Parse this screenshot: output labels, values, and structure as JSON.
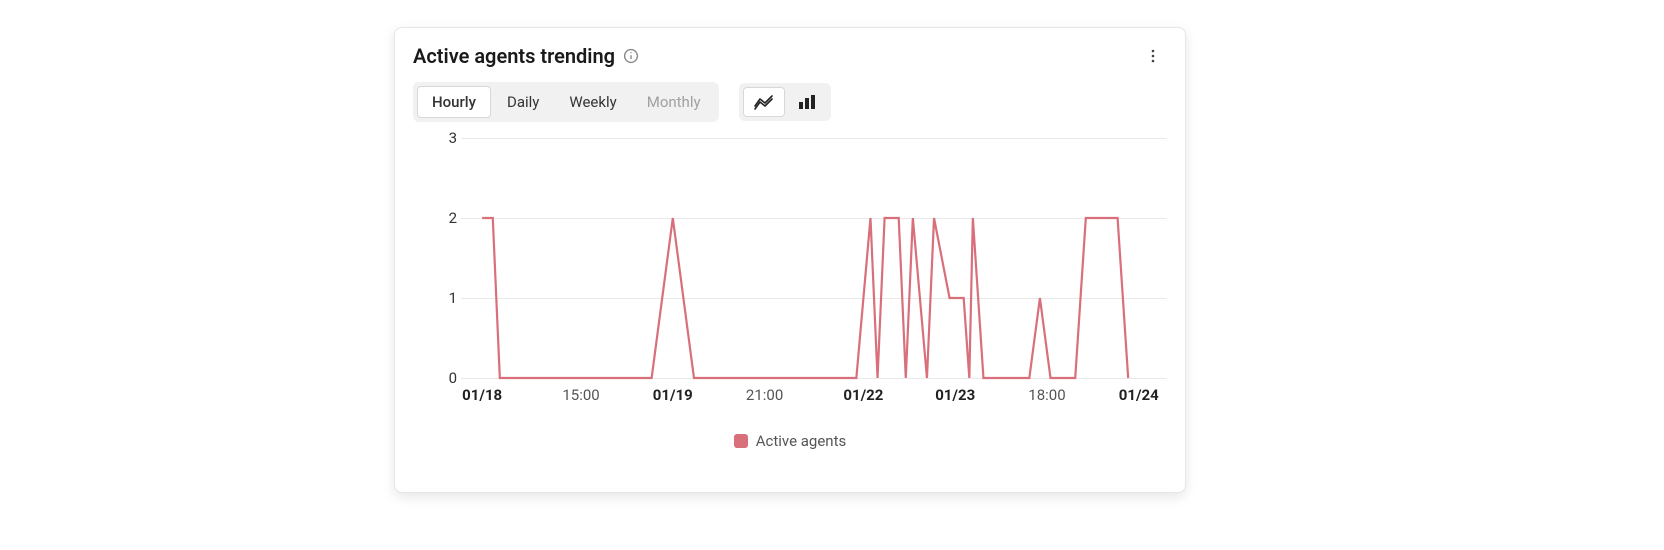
{
  "card": {
    "title": "Active agents trending"
  },
  "tabs": {
    "hourly": "Hourly",
    "daily": "Daily",
    "weekly": "Weekly",
    "monthly": "Monthly"
  },
  "legend": {
    "series1": "Active agents"
  },
  "colors": {
    "series1": "#d96f7a"
  },
  "chart_data": {
    "type": "line",
    "ylabel": "",
    "xlabel": "",
    "ylim": [
      0,
      3
    ],
    "y_ticks": [
      0,
      1,
      2,
      3
    ],
    "x_ticks": [
      {
        "pos": 0.03,
        "label": "01/18",
        "bold": true
      },
      {
        "pos": 0.17,
        "label": "15:00",
        "bold": false
      },
      {
        "pos": 0.3,
        "label": "01/19",
        "bold": true
      },
      {
        "pos": 0.43,
        "label": "21:00",
        "bold": false
      },
      {
        "pos": 0.57,
        "label": "01/22",
        "bold": true
      },
      {
        "pos": 0.7,
        "label": "01/23",
        "bold": true
      },
      {
        "pos": 0.83,
        "label": "18:00",
        "bold": false
      },
      {
        "pos": 0.96,
        "label": "01/24",
        "bold": true
      }
    ],
    "series": [
      {
        "name": "Active agents",
        "color": "#d96f7a",
        "points": [
          {
            "x": 0.03,
            "y": 2
          },
          {
            "x": 0.045,
            "y": 2
          },
          {
            "x": 0.055,
            "y": 0
          },
          {
            "x": 0.27,
            "y": 0
          },
          {
            "x": 0.3,
            "y": 2
          },
          {
            "x": 0.33,
            "y": 0
          },
          {
            "x": 0.56,
            "y": 0
          },
          {
            "x": 0.58,
            "y": 2
          },
          {
            "x": 0.59,
            "y": 0
          },
          {
            "x": 0.6,
            "y": 2
          },
          {
            "x": 0.62,
            "y": 2
          },
          {
            "x": 0.63,
            "y": 0
          },
          {
            "x": 0.64,
            "y": 2
          },
          {
            "x": 0.66,
            "y": 0
          },
          {
            "x": 0.67,
            "y": 2
          },
          {
            "x": 0.692,
            "y": 1
          },
          {
            "x": 0.712,
            "y": 1
          },
          {
            "x": 0.72,
            "y": 0
          },
          {
            "x": 0.725,
            "y": 2
          },
          {
            "x": 0.74,
            "y": 0
          },
          {
            "x": 0.805,
            "y": 0
          },
          {
            "x": 0.82,
            "y": 1
          },
          {
            "x": 0.835,
            "y": 0
          },
          {
            "x": 0.87,
            "y": 0
          },
          {
            "x": 0.885,
            "y": 2
          },
          {
            "x": 0.93,
            "y": 2
          },
          {
            "x": 0.945,
            "y": 0
          }
        ]
      }
    ]
  }
}
